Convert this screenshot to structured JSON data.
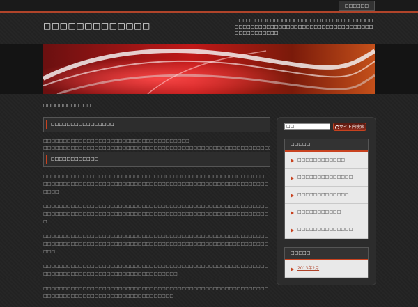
{
  "topbar": {
    "link_label": "□□□□□□"
  },
  "header": {
    "site_title": "□□□□□□□□□□□□□",
    "description": "□□□□□□□□□□□□□□□□□□□□□□□□□□□□□□□□□□□□□□□□□□□□□□□□□□□□□□□□□□□□□□□□□□□□□□□□□□□□□□□□□"
  },
  "breadcrumb": "□□□□□□□□□□□□",
  "main": {
    "section_title": "□□□□□□□□□□□□□□□□",
    "intro_lines": [
      "□□□□□□□□□□□□□□□□□□□□□□□□□□□□□□□□□□□□□",
      "□□□□□□□□□□□□□□□□□□□□□□□□□□□□□□□□□□□□□□□□□□□□□□□□□□□□□□□□□□□□□□□"
    ],
    "article_title": "□□□□□□□□□□□□",
    "paragraphs": [
      "□□□□□□□□□□□□□□□□□□□□□□□□□□□□□□□□□□□□□□□□□□□□□□□□□□□□□□□□□□□□□□□□□□□□□□□□□□□□□□□□□□□□□□□□□□□□□□□□□□□□□□□□□□□□□□□□□□□□□□",
      "□□□□□□□□□□□□□□□□□□□□□□□□□□□□□□□□□□□□□□□□□□□□□□□□□□□□□□□□□□□□□□□□□□□□□□□□□□□□□□□□□□□□□□□□□□□□□□□□□□□□□□□□□□□□□□□□□□□",
      "□□□□□□□□□□□□□□□□□□□□□□□□□□□□□□□□□□□□□□□□□□□□□□□□□□□□□□□□□□□□□□□□□□□□□□□□□□□□□□□□□□□□□□□□□□□□□□□□□□□□□□□□□□□□□□□□□□□□□",
      "□□□□□□□□□□□□□□□□□□□□□□□□□□□□□□□□□□□□□□□□□□□□□□□□□□□□□□□□□□□□□□□□□□□□□□□□□□□□□□□□□□□□□□□□□□□",
      "□□□□□□□□□□□□□□□□□□□□□□□□□□□□□□□□□□□□□□□□□□□□□□□□□□□□□□□□□□□□□□□□□□□□□□□□□□□□□□□□□□□□□□□□□□"
    ]
  },
  "sidebar": {
    "search": {
      "value": "□□",
      "button_label": "サイト内検索"
    },
    "widget1": {
      "title": "□□□□□",
      "items": [
        "□□□□□□□□□□□□",
        "□□□□□□□□□□□□□□",
        "□□□□□□□□□□□□□",
        "□□□□□□□□□□□",
        "□□□□□□□□□□□□□□"
      ]
    },
    "widget2": {
      "title": "□□□□□",
      "items": [
        "2013年2月"
      ]
    }
  },
  "colors": {
    "accent": "#c8421f",
    "background": "#222222",
    "widget_bg": "#e9e9e9"
  }
}
